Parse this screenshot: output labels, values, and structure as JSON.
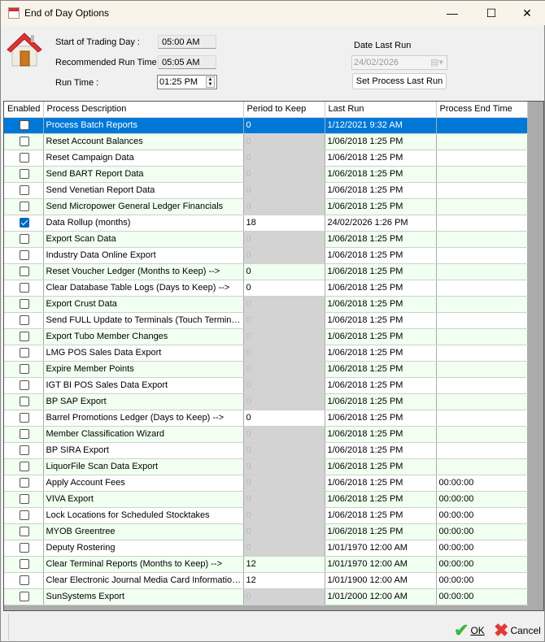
{
  "window": {
    "title": "End of Day Options",
    "minimize": "—",
    "maximize": "☐",
    "close": "✕"
  },
  "settings": {
    "start_label": "Start of Trading Day :",
    "start_value": "05:00 AM",
    "recommended_label": "Recommended Run Time :",
    "recommended_value": "05:05 AM",
    "runtime_label": "Run Time :",
    "runtime_value": "01:25 PM",
    "date_last_run_label": "Date Last Run",
    "date_last_run_value": "24/02/2026",
    "set_button": "Set Process Last Run"
  },
  "columns": [
    "Enabled",
    "Process Description",
    "Period to Keep",
    "Last Run",
    "Process End Time"
  ],
  "rows": [
    {
      "enabled": false,
      "desc": "Process Batch Reports",
      "period": "0",
      "editable": true,
      "last": "1/12/2021 9:32 AM",
      "end": ""
    },
    {
      "enabled": false,
      "desc": "Reset Account Balances",
      "period": "0",
      "editable": false,
      "last": "1/06/2018 1:25 PM",
      "end": ""
    },
    {
      "enabled": false,
      "desc": "Reset Campaign Data",
      "period": "0",
      "editable": false,
      "last": "1/06/2018 1:25 PM",
      "end": ""
    },
    {
      "enabled": false,
      "desc": "Send BART Report Data",
      "period": "0",
      "editable": false,
      "last": "1/06/2018 1:25 PM",
      "end": ""
    },
    {
      "enabled": false,
      "desc": "Send Venetian Report Data",
      "period": "0",
      "editable": false,
      "last": "1/06/2018 1:25 PM",
      "end": ""
    },
    {
      "enabled": false,
      "desc": "Send Micropower General Ledger Financials",
      "period": "0",
      "editable": false,
      "last": "1/06/2018 1:25 PM",
      "end": ""
    },
    {
      "enabled": true,
      "desc": "Data Rollup (months)",
      "period": "18",
      "editable": true,
      "last": "24/02/2026 1:26 PM",
      "end": ""
    },
    {
      "enabled": false,
      "desc": "Export Scan Data",
      "period": "0",
      "editable": false,
      "last": "1/06/2018 1:25 PM",
      "end": ""
    },
    {
      "enabled": false,
      "desc": "Industry Data Online Export",
      "period": "0",
      "editable": false,
      "last": "1/06/2018 1:25 PM",
      "end": ""
    },
    {
      "enabled": false,
      "desc": "Reset Voucher Ledger (Months to Keep) -->",
      "period": "0",
      "editable": true,
      "last": "1/06/2018 1:25 PM",
      "end": ""
    },
    {
      "enabled": false,
      "desc": "Clear Database Table Logs  (Days to Keep) -->",
      "period": "0",
      "editable": true,
      "last": "1/06/2018 1:25 PM",
      "end": ""
    },
    {
      "enabled": false,
      "desc": "Export Crust Data",
      "period": "0",
      "editable": false,
      "last": "1/06/2018 1:25 PM",
      "end": ""
    },
    {
      "enabled": false,
      "desc": "Send FULL Update to Terminals (Touch Terminals Only)",
      "period": "0",
      "editable": false,
      "last": "1/06/2018 1:25 PM",
      "end": ""
    },
    {
      "enabled": false,
      "desc": "Export Tubo Member Changes",
      "period": "0",
      "editable": false,
      "last": "1/06/2018 1:25 PM",
      "end": ""
    },
    {
      "enabled": false,
      "desc": "LMG POS Sales Data Export",
      "period": "0",
      "editable": false,
      "last": "1/06/2018 1:25 PM",
      "end": ""
    },
    {
      "enabled": false,
      "desc": "Expire Member Points",
      "period": "0",
      "editable": false,
      "last": "1/06/2018 1:25 PM",
      "end": ""
    },
    {
      "enabled": false,
      "desc": "IGT BI POS Sales Data Export",
      "period": "0",
      "editable": false,
      "last": "1/06/2018 1:25 PM",
      "end": ""
    },
    {
      "enabled": false,
      "desc": "BP SAP Export",
      "period": "0",
      "editable": false,
      "last": "1/06/2018 1:25 PM",
      "end": ""
    },
    {
      "enabled": false,
      "desc": "Barrel Promotions Ledger  (Days to Keep) -->",
      "period": "0",
      "editable": true,
      "last": "1/06/2018 1:25 PM",
      "end": ""
    },
    {
      "enabled": false,
      "desc": "Member Classification Wizard",
      "period": "0",
      "editable": false,
      "last": "1/06/2018 1:25 PM",
      "end": ""
    },
    {
      "enabled": false,
      "desc": "BP SIRA Export",
      "period": "0",
      "editable": false,
      "last": "1/06/2018 1:25 PM",
      "end": ""
    },
    {
      "enabled": false,
      "desc": "LiquorFile Scan Data Export",
      "period": "0",
      "editable": false,
      "last": "1/06/2018 1:25 PM",
      "end": ""
    },
    {
      "enabled": false,
      "desc": "Apply Account Fees",
      "period": "0",
      "editable": false,
      "last": "1/06/2018 1:25 PM",
      "end": "00:00:00"
    },
    {
      "enabled": false,
      "desc": "VIVA Export",
      "period": "0",
      "editable": false,
      "last": "1/06/2018 1:25 PM",
      "end": "00:00:00"
    },
    {
      "enabled": false,
      "desc": "Lock Locations for Scheduled Stocktakes",
      "period": "0",
      "editable": false,
      "last": "1/06/2018 1:25 PM",
      "end": "00:00:00"
    },
    {
      "enabled": false,
      "desc": "MYOB Greentree",
      "period": "0",
      "editable": false,
      "last": "1/06/2018 1:25 PM",
      "end": "00:00:00"
    },
    {
      "enabled": false,
      "desc": "Deputy Rostering",
      "period": "0",
      "editable": false,
      "last": "1/01/1970 12:00 AM",
      "end": "00:00:00"
    },
    {
      "enabled": false,
      "desc": "Clear Terminal Reports   (Months to Keep) -->",
      "period": "12",
      "editable": true,
      "last": "1/01/1970 12:00 AM",
      "end": "00:00:00"
    },
    {
      "enabled": false,
      "desc": "Clear Electronic Journal Media Card Information (Months to Keep)",
      "period": "12",
      "editable": true,
      "last": "1/01/1900 12:00 AM",
      "end": "00:00:00"
    },
    {
      "enabled": false,
      "desc": "SunSystems Export",
      "period": "0",
      "editable": false,
      "last": "1/01/2000 12:00 AM",
      "end": "00:00:00"
    }
  ],
  "footer": {
    "ok": "OK",
    "cancel": "Cancel"
  },
  "colors": {
    "selection": "#0078d7",
    "alt_row": "#f0fff0",
    "disabled_cell": "#d3d3d3"
  }
}
